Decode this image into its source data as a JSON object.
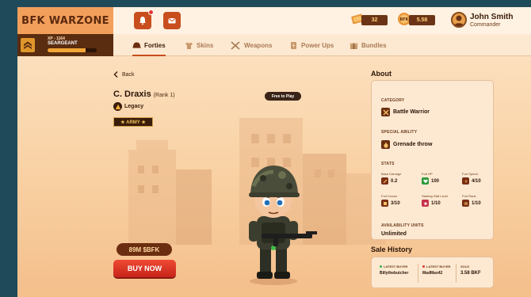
{
  "header": {
    "logo": "BFK WARZONE",
    "currency_a": "32",
    "currency_b": "5.58",
    "user_name": "John Smith",
    "user_role": "Commander",
    "notification_dot": true
  },
  "rank": {
    "xp": "XP - 1164",
    "title": "SEARGEANT",
    "progress": 0.78
  },
  "nav": {
    "tabs": [
      {
        "label": "Forties",
        "icon": "helmet-icon",
        "active": true
      },
      {
        "label": "Skins",
        "icon": "skins-icon",
        "active": false
      },
      {
        "label": "Weapons",
        "icon": "weapons-icon",
        "active": false
      },
      {
        "label": "Power Ups",
        "icon": "power-ups-icon",
        "active": false
      },
      {
        "label": "Bundles",
        "icon": "bundles-icon",
        "active": false
      }
    ]
  },
  "character": {
    "back_label": "Back",
    "name": "C. Draxis",
    "rank": "(Rank 1)",
    "tier": "Legacy",
    "faction": "★ ARMY ★",
    "free_badge": "Free to Play",
    "price": "89M $BFK",
    "buy_label": "BUY NOW"
  },
  "about": {
    "title": "About",
    "category_label": "CATEGORY",
    "category": "Battle Warrior",
    "ability_label": "SPECIAL ABILITY",
    "ability": "Grenade throw",
    "stats_label": "STATS",
    "stats": [
      {
        "label": "Base Damage",
        "value": "0.2",
        "color": "#7a2e12"
      },
      {
        "label": "Fort HP",
        "value": "100",
        "color": "#2e9a3a"
      },
      {
        "label": "Fort Speed",
        "value": "4/10",
        "color": "#7a2e12"
      },
      {
        "label": "Fort Knowz",
        "value": "3/10",
        "color": "#7a2e12"
      },
      {
        "label": "Starting Skill Level",
        "value": "1/10",
        "color": "#c8304a"
      },
      {
        "label": "Fort Rank",
        "value": "1/10",
        "color": "#7a2e12"
      }
    ],
    "availability_label": "AVAILABILITY UNITS",
    "availability": "Unlimited"
  },
  "sale": {
    "title": "Sale History",
    "latest_buyer_label": "LATEST BUYER",
    "latest_buyer": "Billythebutcher",
    "latest_buyer_dot": "#39b24a",
    "prev_buyer_label": "LATEST BUYER",
    "prev_buyer": "MadMax42",
    "prev_buyer_dot": "#e8352a",
    "sold_label": "SOLD",
    "sold": "3.58 BKF"
  }
}
